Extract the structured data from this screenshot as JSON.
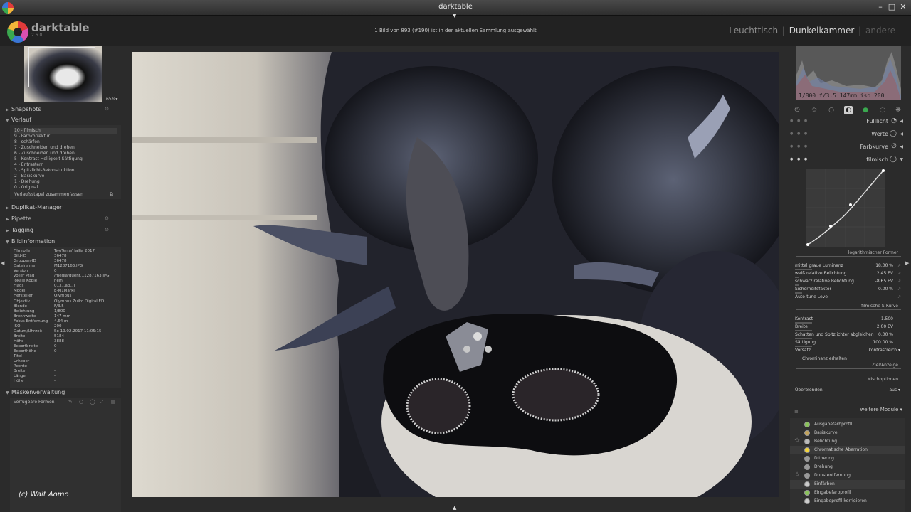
{
  "window": {
    "title": "darktable",
    "min": "–",
    "max": "□",
    "close": "✕",
    "top_arrow": "▼",
    "bottom_arrow": "▲"
  },
  "app": {
    "logo_text": "darktable",
    "version": "2.6.0"
  },
  "status_message": "1 Bild von 893 (#190) ist in der aktuellen Sammlung ausgewählt",
  "views": {
    "lighttable": "Leuchttisch",
    "darkroom": "Dunkelkammer",
    "other": "andere",
    "sep": "|"
  },
  "navigation": {
    "zoom": "65%▾"
  },
  "left_panel": {
    "snapshots": "Snapshots",
    "history": "Verlauf",
    "history_items": [
      "10 - filmisch",
      "9 - Farbkorrektur",
      "8 - schärfen",
      "7 - Zuschneiden und drehen",
      "6 - Zuschneiden und drehen",
      "5 - Kontrast Helligkeit Sättigung",
      "4 - Entrastern",
      "3 - Spitzlicht-Rekonstruktion",
      "2 - Basiskurve",
      "1 - Drehung",
      "0 - Original"
    ],
    "history_compress": "Verlaufsstapel zusammenfassen",
    "duplicate": "Duplikat-Manager",
    "pipette": "Pipette",
    "tagging": "Tagging",
    "image_info": "Bildinformation",
    "info_rows": [
      [
        "Filmrolle",
        "TwoTerra/Hallia 2017"
      ],
      [
        "Bild-ID",
        "36478"
      ],
      [
        "Gruppen-ID",
        "36478"
      ],
      [
        "Dateiname",
        "M1287163.JPG"
      ],
      [
        "Version",
        "0"
      ],
      [
        "voller Pfad",
        "/media/quent...1287163.JPG"
      ],
      [
        "lokale Kopie",
        "nein"
      ],
      [
        "Flags",
        "0...l...ap...j"
      ],
      [
        "Modell",
        "E-M1MarkII"
      ],
      [
        "Hersteller",
        "Olympus"
      ],
      [
        "Objektiv",
        "Olympus Zuiko Digital ED ..."
      ],
      [
        "Blende",
        "F/3.5"
      ],
      [
        "Belichtung",
        "1/800"
      ],
      [
        "Brennweite",
        "147 mm"
      ],
      [
        "Fokus-Entfernung",
        "4.64 m"
      ],
      [
        "ISO",
        "200"
      ],
      [
        "Datum/Uhrzeit",
        "So 19.02.2017 11:05:15"
      ],
      [
        "Breite",
        "5184"
      ],
      [
        "Höhe",
        "3888"
      ],
      [
        "Exportbreite",
        "0"
      ],
      [
        "Exporthöhe",
        "0"
      ],
      [
        "Titel",
        "-"
      ],
      [
        "Urheber",
        "-"
      ],
      [
        "Rechte",
        "-"
      ],
      [
        "Breite",
        "-"
      ],
      [
        "Länge",
        "-"
      ],
      [
        "Höhe",
        "-"
      ]
    ],
    "mask_manager": "Maskenverwaltung",
    "available_shapes": "Verfügbare Formen"
  },
  "watermark": "(c) Wait Aomo",
  "right_panel": {
    "exif_line": "1/800 f/3.5 147mm iso 200",
    "modules": [
      {
        "name": "Fülllicht",
        "icon": "◔"
      },
      {
        "name": "Werte",
        "icon": "◯"
      },
      {
        "name": "Farbkurve",
        "icon": "∅"
      },
      {
        "name": "filmisch",
        "icon": "◯"
      }
    ],
    "log_shaper": "logarithmischer Former",
    "params_log": [
      {
        "label": "mittel graue Luminanz",
        "value": "18.00 %"
      },
      {
        "label": "weiß relative Belichtung",
        "value": "2.45 EV"
      },
      {
        "label": "schwarz relative Belichtung",
        "value": "-8.65 EV"
      },
      {
        "label": "Sicherheitsfaktor",
        "value": "0.00 %"
      },
      {
        "label": "Auto-tune Level",
        "value": ""
      }
    ],
    "s_curve": "filmische S-Kurve",
    "params_curve": [
      {
        "label": "Kontrast",
        "value": "1.500"
      },
      {
        "label": "Breite",
        "value": "2.00 EV"
      },
      {
        "label": "Schatten und Spitzlichter abgleichen",
        "value": "0.00 %"
      },
      {
        "label": "Sättigung",
        "value": "100.00 %"
      }
    ],
    "preset_label": "Vorsatz",
    "preset_value": "kontrastreich ▾",
    "chroma": "Chrominanz erhalten",
    "destination": "Ziel/Anzeige",
    "blend_options": "Mischoptionen",
    "blend_label": "Überblenden",
    "blend_value": "aus ▾",
    "more_modules": "weitere Module ▾",
    "more_list": [
      {
        "name": "Ausgabefarbprofil",
        "star": "",
        "color": "#8ac35a"
      },
      {
        "name": "Basiskurve",
        "star": "",
        "color": "#c3a35a"
      },
      {
        "name": "Belichtung",
        "star": "☆",
        "color": "#bbbbbb"
      },
      {
        "name": "Chromatische Aberration",
        "star": "",
        "color": "#f2d33a"
      },
      {
        "name": "Dithering",
        "star": "",
        "color": "#999999"
      },
      {
        "name": "Drehung",
        "star": "",
        "color": "#999999"
      },
      {
        "name": "Dunstentfernung",
        "star": "☆",
        "color": "#999999"
      },
      {
        "name": "Einfärben",
        "star": "",
        "color": "#cccccc"
      },
      {
        "name": "Eingabefarbprofil",
        "star": "",
        "color": "#8ac35a"
      },
      {
        "name": "Eingabeprofil korrigieren",
        "star": "",
        "color": "#cccccc"
      }
    ]
  }
}
